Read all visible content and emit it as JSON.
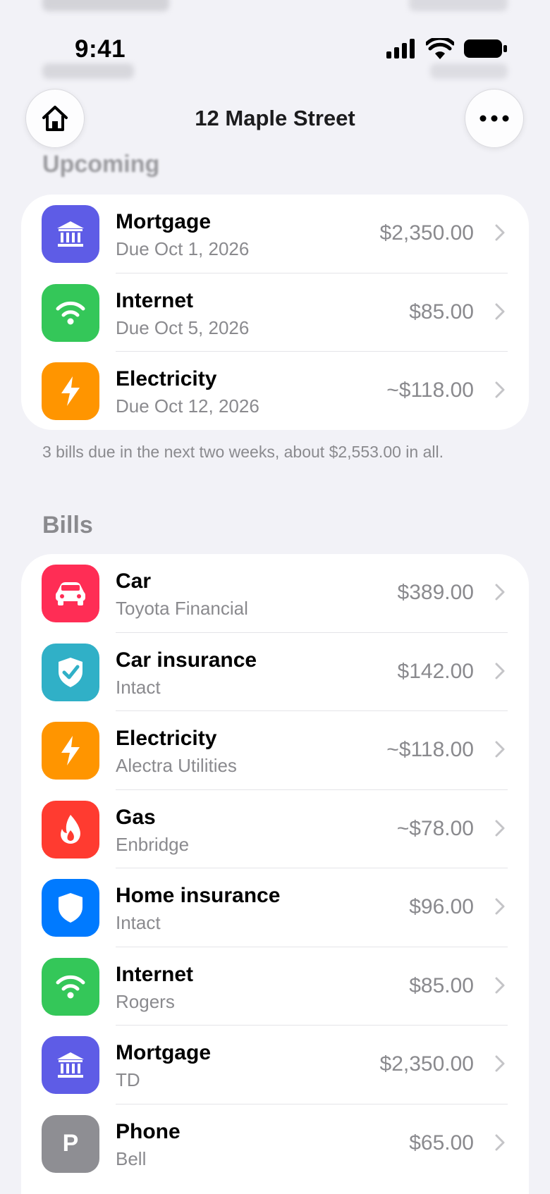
{
  "status": {
    "time": "9:41"
  },
  "nav": {
    "title": "12 Maple Street"
  },
  "upcoming": {
    "header": "Upcoming",
    "footnote": "3 bills due in the next two weeks, about $2,553.00 in all.",
    "items": [
      {
        "title": "Mortgage",
        "subtitle": "Due Oct 1, 2026",
        "amount": "$2,350.00",
        "icon": "bank-icon",
        "color": "#5e5ce6"
      },
      {
        "title": "Internet",
        "subtitle": "Due Oct 5, 2026",
        "amount": "$85.00",
        "icon": "wifi-icon",
        "color": "#34c759"
      },
      {
        "title": "Electricity",
        "subtitle": "Due Oct 12, 2026",
        "amount": "~$118.00",
        "icon": "bolt-icon",
        "color": "#ff9500"
      }
    ]
  },
  "bills": {
    "header": "Bills",
    "items": [
      {
        "title": "Car",
        "subtitle": "Toyota Financial",
        "amount": "$389.00",
        "icon": "car-icon",
        "color": "#ff2d55"
      },
      {
        "title": "Car insurance",
        "subtitle": "Intact",
        "amount": "$142.00",
        "icon": "shield-check-icon",
        "color": "#30b0c7"
      },
      {
        "title": "Electricity",
        "subtitle": "Alectra Utilities",
        "amount": "~$118.00",
        "icon": "bolt-icon",
        "color": "#ff9500"
      },
      {
        "title": "Gas",
        "subtitle": "Enbridge",
        "amount": "~$78.00",
        "icon": "flame-icon",
        "color": "#ff3b30"
      },
      {
        "title": "Home insurance",
        "subtitle": "Intact",
        "amount": "$96.00",
        "icon": "shield-icon",
        "color": "#007aff"
      },
      {
        "title": "Internet",
        "subtitle": "Rogers",
        "amount": "$85.00",
        "icon": "wifi-icon",
        "color": "#34c759"
      },
      {
        "title": "Mortgage",
        "subtitle": "TD",
        "amount": "$2,350.00",
        "icon": "bank-icon",
        "color": "#5e5ce6"
      },
      {
        "title": "Phone",
        "subtitle": "Bell",
        "amount": "$65.00",
        "icon": "letter-p-icon",
        "letter": "P",
        "color": "#8e8e93"
      }
    ]
  }
}
